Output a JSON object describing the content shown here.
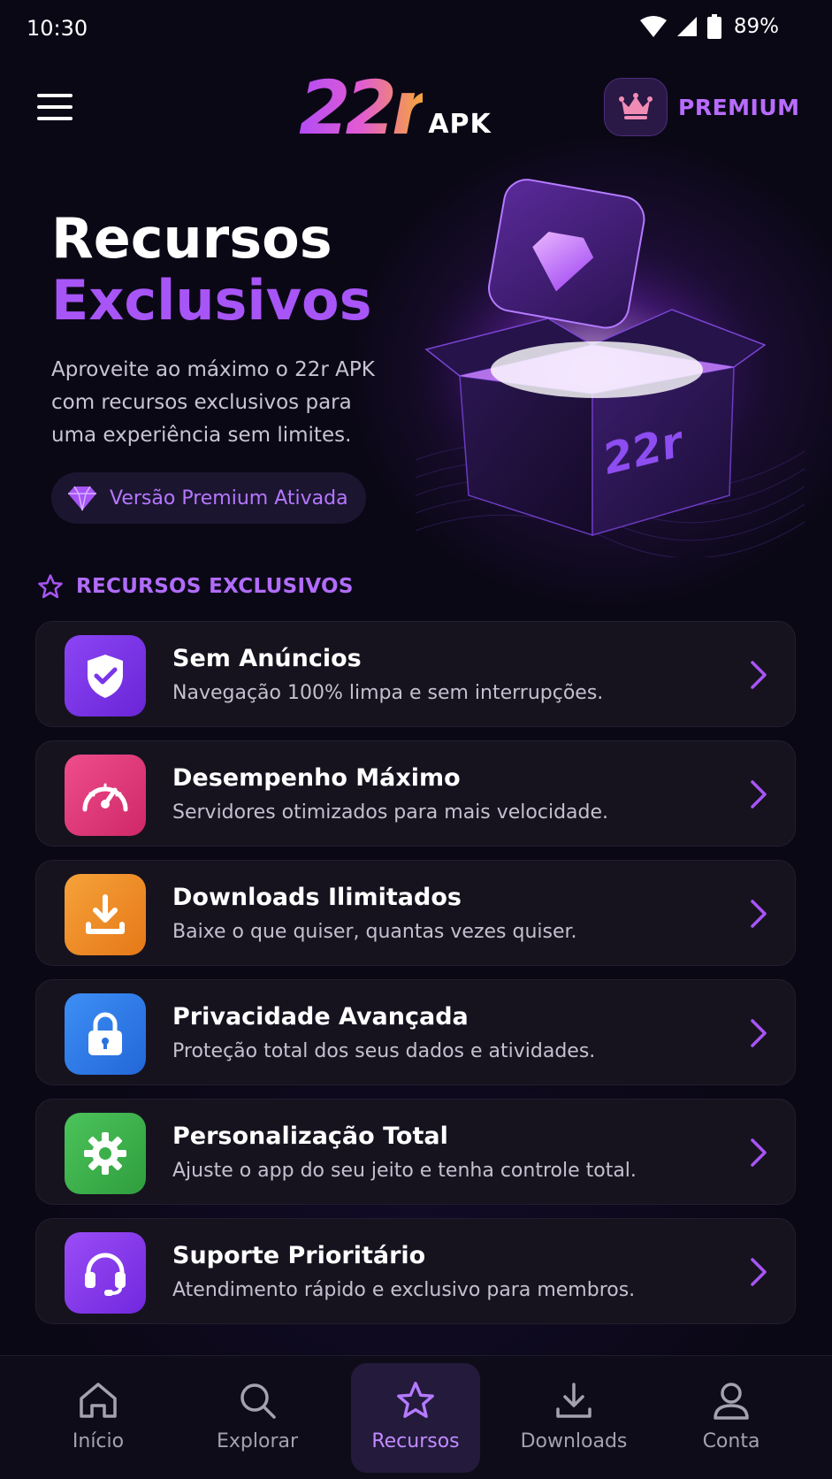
{
  "status_bar": {
    "time": "10:30",
    "battery": "89%"
  },
  "header": {
    "logo_main": "22r",
    "logo_sub": "APK",
    "premium_label": "PREMIUM"
  },
  "hero": {
    "title_line1": "Recursos",
    "title_line2": "Exclusivos",
    "description": "Aproveite ao máximo o 22r APK com recursos exclusivos para uma experiência sem limites.",
    "premium_badge": "Versão Premium Ativada",
    "box_logo": "22r"
  },
  "section": {
    "title": "RECURSOS EXCLUSIVOS"
  },
  "features": [
    {
      "title": "Sem Anúncios",
      "description": "Navegação 100% limpa e sem interrupções.",
      "icon": "shield-check-icon",
      "color": "#7c3aed"
    },
    {
      "title": "Desempenho Máximo",
      "description": "Servidores otimizados para mais velocidade.",
      "icon": "speedometer-icon",
      "color": "#e23a7a"
    },
    {
      "title": "Downloads Ilimitados",
      "description": "Baixe o que quiser, quantas vezes quiser.",
      "icon": "download-icon",
      "color": "#f08a24"
    },
    {
      "title": "Privacidade Avançada",
      "description": "Proteção total dos seus dados e atividades.",
      "icon": "lock-icon",
      "color": "#2f7de8"
    },
    {
      "title": "Personalização Total",
      "description": "Ajuste o app do seu jeito e tenha controle total.",
      "icon": "gear-icon",
      "color": "#3bb54a"
    },
    {
      "title": "Suporte Prioritário",
      "description": "Atendimento rápido e exclusivo para membros.",
      "icon": "headset-icon",
      "color": "#8b3ff0"
    }
  ],
  "bottom_nav": [
    {
      "label": "Início",
      "icon": "home-icon",
      "active": false
    },
    {
      "label": "Explorar",
      "icon": "search-icon",
      "active": false
    },
    {
      "label": "Recursos",
      "icon": "star-icon",
      "active": true
    },
    {
      "label": "Downloads",
      "icon": "download-icon",
      "active": false
    },
    {
      "label": "Conta",
      "icon": "user-icon",
      "active": false
    }
  ],
  "colors": {
    "accent": "#a855f7",
    "background": "#0b0816",
    "card": "#16131f"
  }
}
